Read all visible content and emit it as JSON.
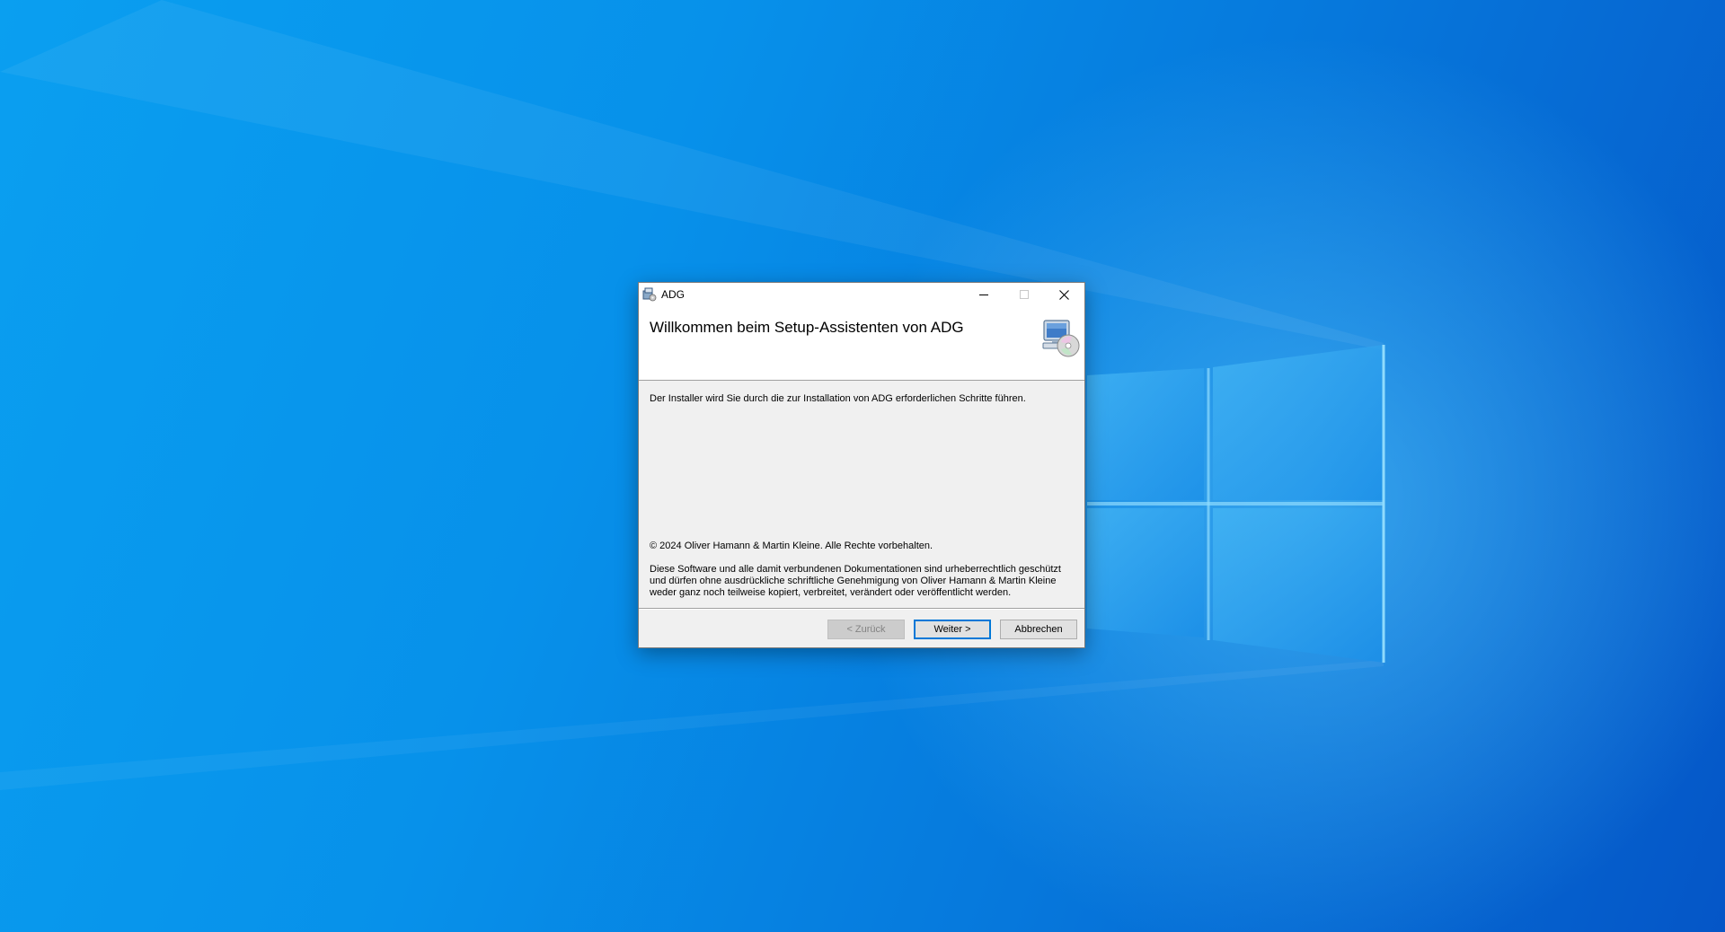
{
  "window": {
    "title": "ADG",
    "minimize_icon": "minimize-icon",
    "maximize_icon": "maximize-icon",
    "close_icon": "close-icon"
  },
  "header": {
    "title": "Willkommen beim Setup-Assistenten von ADG",
    "icon": "computer-cd-icon"
  },
  "content": {
    "intro": "Der Installer wird Sie durch die zur Installation von ADG erforderlichen Schritte führen.",
    "copyright": "© 2024 Oliver Hamann & Martin Kleine. Alle Rechte vorbehalten.",
    "legal": "Diese Software und alle damit verbundenen Dokumentationen sind urheberrechtlich geschützt und dürfen ohne ausdrückliche schriftliche Genehmigung von Oliver Hamann & Martin Kleine weder ganz noch teilweise kopiert, verbreitet, verändert oder veröffentlicht werden."
  },
  "footer": {
    "back_label": "< Zurück",
    "next_label": "Weiter >",
    "cancel_label": "Abbrechen"
  },
  "colors": {
    "accent": "#0078d7",
    "desktop": "#0791ea"
  }
}
